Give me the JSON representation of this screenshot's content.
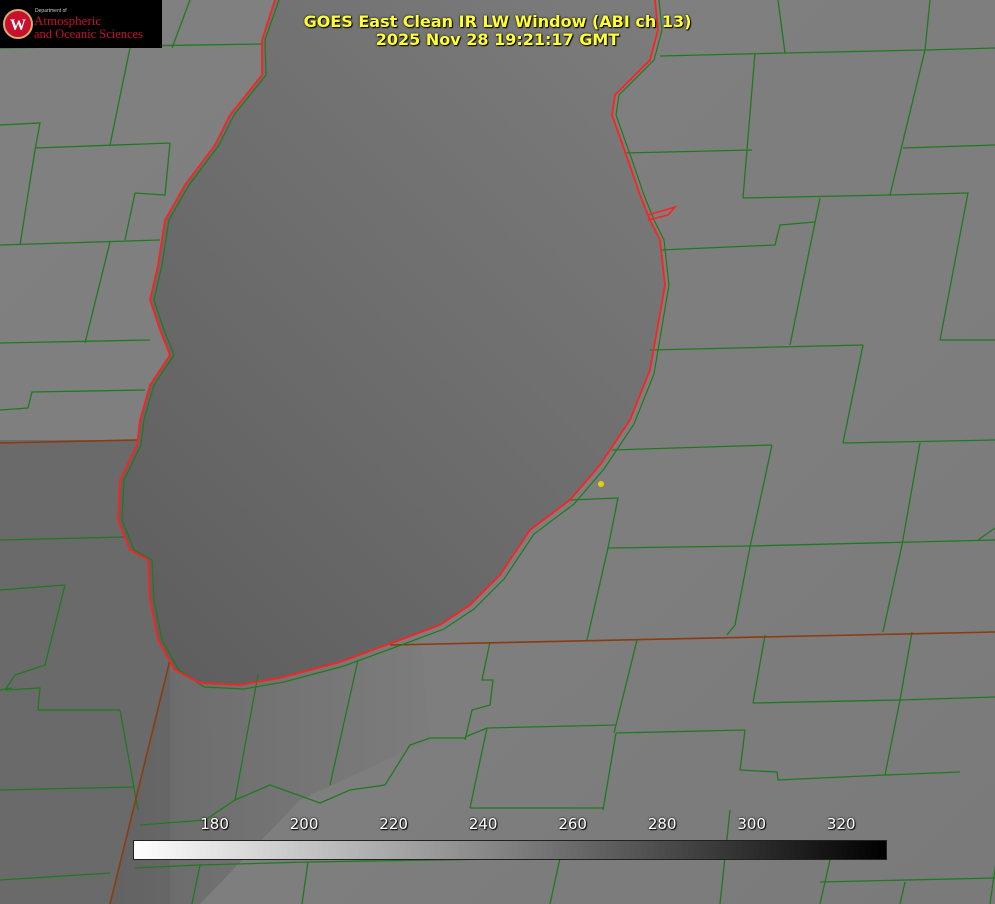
{
  "image": {
    "title_line1": "GOES East Clean IR LW Window (ABI ch 13)",
    "title_line2": "2025 Nov 28 19:21:17 GMT"
  },
  "logo": {
    "dept_text": "Department of",
    "name_line1": "Atmospheric",
    "name_line2": "and Oceanic Sciences",
    "emblem": "W-crest-icon"
  },
  "colorbar": {
    "ticks": [
      "180",
      "200",
      "220",
      "240",
      "260",
      "280",
      "300",
      "320"
    ],
    "range": [
      162,
      330
    ],
    "gradient": [
      "#ffffff",
      "#000000"
    ]
  },
  "colors": {
    "county_lines": "#1f7a1f",
    "state_lines": "#8a3c10",
    "lake_outline": "#ff2020",
    "title_text": "#ffff33",
    "marker": "#e6d000"
  }
}
